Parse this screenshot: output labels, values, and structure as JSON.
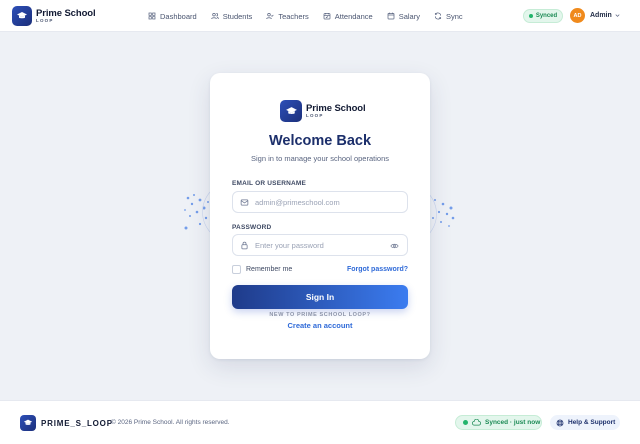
{
  "header": {
    "brand_name": "Prime School",
    "brand_sub": "LOOP",
    "nav": [
      {
        "label": "Dashboard",
        "icon": "grid-icon"
      },
      {
        "label": "Students",
        "icon": "users-icon"
      },
      {
        "label": "Teachers",
        "icon": "user-check-icon"
      },
      {
        "label": "Attendance",
        "icon": "calendar-check-icon"
      },
      {
        "label": "Salary",
        "icon": "wallet-icon"
      },
      {
        "label": "Sync",
        "icon": "refresh-icon"
      }
    ],
    "sync_status": "Synced",
    "avatar_initials": "AD",
    "user_name": "Admin"
  },
  "login": {
    "brand_name": "Prime School",
    "brand_sub": "LOOP",
    "title": "Welcome Back",
    "subtitle": "Sign in to manage your school operations",
    "email_label": "EMAIL OR USERNAME",
    "email_placeholder": "admin@primeschool.com",
    "password_label": "PASSWORD",
    "password_placeholder": "Enter your password",
    "remember_label": "Remember me",
    "forgot_label": "Forgot password?",
    "signin_label": "Sign In",
    "new_to_label": "NEW TO PRIME SCHOOL LOOP?",
    "create_label": "Create an account"
  },
  "footer": {
    "brand_name": "PRIME_S_LOOP",
    "copyright": "© 2026 Prime School. All rights reserved.",
    "sync_label": "Synced · just now",
    "help_label": "Help & Support"
  },
  "colors": {
    "accent": "#2f6ad8",
    "brand_dark": "#1c2f6b",
    "success": "#22b46b",
    "avatar": "#f08a1c"
  }
}
